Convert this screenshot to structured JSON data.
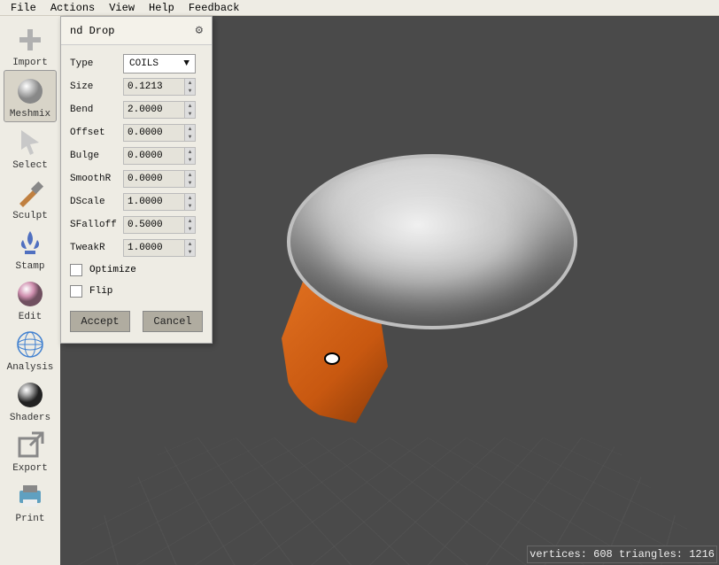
{
  "menu": {
    "items": [
      "File",
      "Actions",
      "View",
      "Help",
      "Feedback"
    ]
  },
  "sidebar": {
    "tools": [
      {
        "label": "Import"
      },
      {
        "label": "Meshmix"
      },
      {
        "label": "Select"
      },
      {
        "label": "Sculpt"
      },
      {
        "label": "Stamp"
      },
      {
        "label": "Edit"
      },
      {
        "label": "Analysis"
      },
      {
        "label": "Shaders"
      },
      {
        "label": "Export"
      },
      {
        "label": "Print"
      }
    ]
  },
  "panel": {
    "title": "nd Drop",
    "props": {
      "type_label": "Type",
      "type_value": "COILS",
      "size_label": "Size",
      "size_value": "0.1213",
      "bend_label": "Bend",
      "bend_value": "2.0000",
      "offset_label": "Offset",
      "offset_value": "0.0000",
      "bulge_label": "Bulge",
      "bulge_value": "0.0000",
      "smoothr_label": "SmoothR",
      "smoothr_value": "0.0000",
      "dscale_label": "DScale",
      "dscale_value": "1.0000",
      "sfalloff_label": "SFalloff",
      "sfalloff_value": "0.5000",
      "tweakr_label": "TweakR",
      "tweakr_value": "1.0000"
    },
    "optimize_label": "Optimize",
    "flip_label": "Flip",
    "accept_label": "Accept",
    "cancel_label": "Cancel"
  },
  "status": {
    "vertices_label": "vertices:",
    "vertices": "608",
    "triangles_label": "triangles:",
    "triangles": "1216"
  }
}
